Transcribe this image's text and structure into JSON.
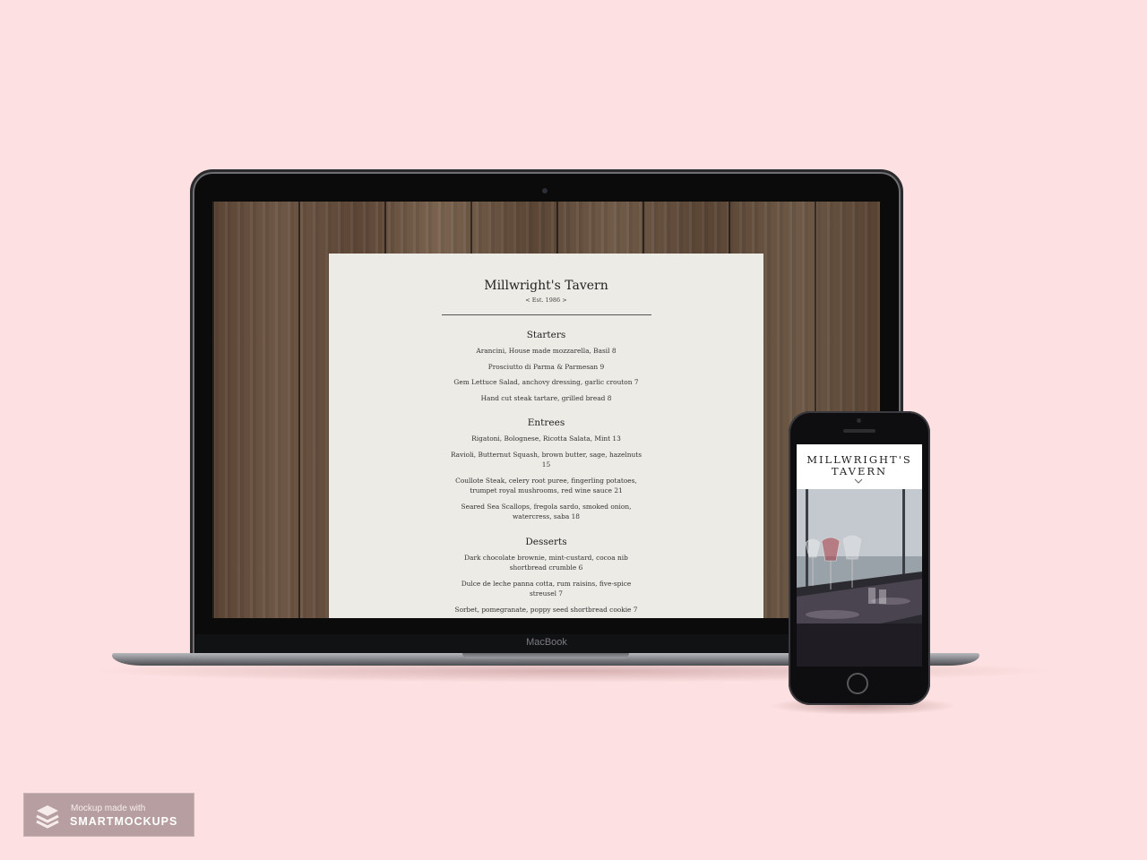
{
  "laptop": {
    "brand_label": "MacBook",
    "menu": {
      "title": "Millwright's Tavern",
      "established": "< Est. 1986 >",
      "sections": [
        {
          "name": "Starters",
          "items": [
            "Arancini, House made mozzarella, Basil 8",
            "Prosciutto di Parma & Parmesan 9",
            "Gem Lettuce Salad, anchovy dressing, garlic crouton 7",
            "Hand cut steak tartare, grilled bread 8"
          ]
        },
        {
          "name": "Entrees",
          "items": [
            "Rigatoni, Bolognese, Ricotta Salata, Mint 13",
            "Ravioli, Butternut Squash, brown butter, sage, hazelnuts 15",
            "Coullote Steak, celery root puree, fingerling potatoes, trumpet royal mushrooms, red wine sauce 21",
            "Seared Sea Scallops, fregola sardo, smoked onion, watercress, saba 18"
          ]
        },
        {
          "name": "Desserts",
          "items": [
            "Dark chocolate brownie, mint-custard, cocoa nib shortbread crumble 6",
            "Dulce de leche panna cotta, rum raisins, five-spice streusel 7",
            "Sorbet, pomegranate, poppy seed shortbread cookie 7"
          ]
        }
      ]
    }
  },
  "phone": {
    "title_line1": "MILLWRIGHT'S",
    "title_line2": "TAVERN",
    "scroll_icon": "chevron-down-icon"
  },
  "watermark": {
    "line1": "Mockup made with",
    "line2": "SMARTMOCKUPS",
    "icon": "layers-icon"
  },
  "colors": {
    "background": "#fde0e1",
    "menu_paper": "#ecebe6",
    "badge": "#b79fa1"
  }
}
